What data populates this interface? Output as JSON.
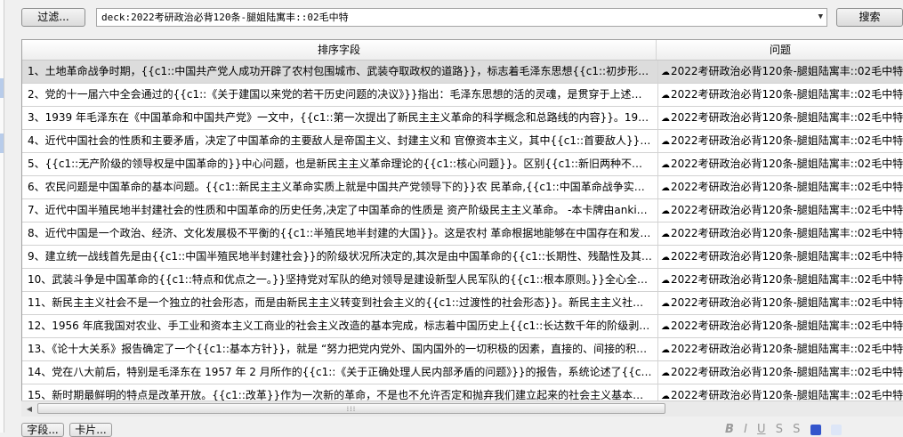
{
  "toolbar": {
    "filter_label": "过滤...",
    "search_query": "deck:2022考研政治必背120条-腿姐陆寓丰::02毛中特",
    "search_label": "搜索"
  },
  "table": {
    "columns": [
      "排序字段",
      "问题"
    ],
    "selected_row": 0,
    "rows": [
      {
        "sort_field": "1、土地革命战争时期，{{c1::中国共产党人成功开辟了农村包围城市、武装夺取政权的道路}}，标志着毛泽东思想{{c1::初步形成}}。…",
        "question": "2022考研政治必背120条-腿姐陆寓丰::02毛中特"
      },
      {
        "sort_field": "2、党的十一届六中全会通过的{{c1::《关于建国以来党的若干历史问题的决议》}}指出：毛泽东思想的活的灵魂，是贯穿于上述各个…",
        "question": "2022考研政治必背120条-腿姐陆寓丰::02毛中特"
      },
      {
        "sort_field": "3、1939 年毛泽东在《中国革命和中国共产党》一文中，{{c1::第一次提出了新民主主义革命的科学概念和总路线的内容}}。1948 …",
        "question": "2022考研政治必背120条-腿姐陆寓丰::02毛中特"
      },
      {
        "sort_field": "4、近代中国社会的性质和主要矛盾，决定了中国革命的主要敌人是帝国主义、封建主义和 官僚资本主义，其中{{c1::首要敌人}}是{{…",
        "question": "2022考研政治必背120条-腿姐陆寓丰::02毛中特"
      },
      {
        "sort_field": "5、{{c1::无产阶级的领导权是中国革命的}}中心问题，也是新民主主义革命理论的{{c1::核心问题}}。区别{{c1::新旧两种不同范畴的民…",
        "question": "2022考研政治必背120条-腿姐陆寓丰::02毛中特"
      },
      {
        "sort_field": "6、农民问题是中国革命的基本问题。{{c1::新民主主义革命实质上就是中国共产党领导下的}}农 民革命,{{c1::中国革命战争实质上就…",
        "question": "2022考研政治必背120条-腿姐陆寓丰::02毛中特"
      },
      {
        "sort_field": "7、近代中国半殖民地半封建社会的性质和中国革命的历史任务,决定了中国革命的性质是 资产阶级民主主义革命。 -本卡牌由anki…",
        "question": "2022考研政治必背120条-腿姐陆寓丰::02毛中特"
      },
      {
        "sort_field": "8、近代中国是一个政治、经济、文化发展极不平衡的{{c1::半殖民地半封建的大国}}。这是农村 革命根据地能够在中国存在和发展…",
        "question": "2022考研政治必背120条-腿姐陆寓丰::02毛中特"
      },
      {
        "sort_field": "9、建立统一战线首先是由{{c1::中国半殖民地半封建社会}}的阶级状况所决定的,其次是由中国革命的{{c1::长期性、残酷性及其发展…",
        "question": "2022考研政治必背120条-腿姐陆寓丰::02毛中特"
      },
      {
        "sort_field": "10、武装斗争是中国革命的{{c1::特点和优点之一。}}坚持党对军队的绝对领导是建设新型人民军队的{{c1::根本原则。}}全心全意为…",
        "question": "2022考研政治必背120条-腿姐陆寓丰::02毛中特"
      },
      {
        "sort_field": "11、新民主主义社会不是一个独立的社会形态，而是由新民主主义转变到社会主义的{{c1::过渡性的社会形态}}。新民主主义社会的{{…",
        "question": "2022考研政治必背120条-腿姐陆寓丰::02毛中特"
      },
      {
        "sort_field": "12、1956 年底我国对农业、手工业和资本主义工商业的社会主义改造的基本完成，标志着中国历史上{{c1::长达数千年的阶级剥削…",
        "question": "2022考研政治必背120条-腿姐陆寓丰::02毛中特"
      },
      {
        "sort_field": "13、《论十大关系》报告确定了一个{{c1::基本方针}}，就是 “努力把党内党外、国内国外的一切积极的因素，直接的、间接的积极…",
        "question": "2022考研政治必背120条-腿姐陆寓丰::02毛中特"
      },
      {
        "sort_field": "14、党在八大前后，特别是毛泽东在 1957 年 2 月所作的{{c1::《关于正确处理人民内部矛盾的问题》}}的报告，系统论述了{{c1::社…",
        "question": "2022考研政治必背120条-腿姐陆寓丰::02毛中特"
      },
      {
        "sort_field": "15、新时期最鲜明的特点是改革开放。{{c1::改革}}作为一次新的革命，不是也不允许否定和抛弃我们建立起来的社会主义基本制度…",
        "question": "2022考研政治必背120条-腿姐陆寓丰::02毛中特"
      }
    ]
  },
  "bottom_tabs": [
    "字段...",
    "卡片..."
  ],
  "editor_tools": [
    "B",
    "I",
    "U",
    "S",
    "S"
  ],
  "colors": {
    "selected_row": "#dcdcdc",
    "swatch_blue": "#3355cc",
    "swatch_light": "#dde6f7"
  }
}
